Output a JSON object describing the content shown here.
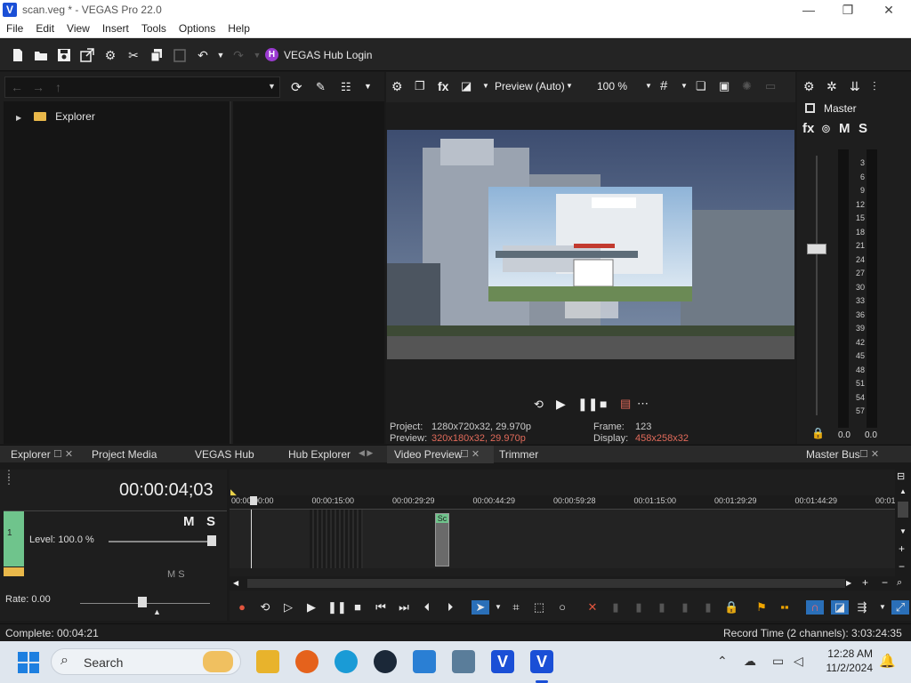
{
  "window": {
    "title": "scan.veg * - VEGAS Pro 22.0",
    "minimize": "—",
    "maximize": "❐",
    "close": "✕"
  },
  "menu": [
    "File",
    "Edit",
    "View",
    "Insert",
    "Tools",
    "Options",
    "Help"
  ],
  "toolbar": {
    "hub_login": "VEGAS Hub Login"
  },
  "explorer": {
    "root": "Explorer"
  },
  "preview": {
    "mode": "Preview (Auto)",
    "zoom": "100 %",
    "project_label": "Project:",
    "project_value": "1280x720x32, 29.970p",
    "preview_label": "Preview:",
    "preview_value": "320x180x32, 29.970p",
    "frame_label": "Frame:",
    "frame_value": "123",
    "display_label": "Display:",
    "display_value": "458x258x32"
  },
  "master": {
    "label": "Master",
    "m": "M",
    "s": "S",
    "scale": [
      "3",
      "6",
      "9",
      "12",
      "15",
      "18",
      "21",
      "24",
      "27",
      "30",
      "33",
      "36",
      "39",
      "42",
      "45",
      "48",
      "51",
      "54",
      "57"
    ],
    "left_value": "0.0",
    "right_value": "0.0"
  },
  "dock_tabs": [
    "Explorer",
    "Project Media",
    "VEGAS Hub",
    "Hub Explorer",
    "Video Preview",
    "Trimmer",
    "Master Bus"
  ],
  "timeline": {
    "timecode": "00:00:04;03",
    "track_m": "M",
    "track_s": "S",
    "level": "Level: 100.0 %",
    "rate": "Rate: 0.00",
    "event_label": "Sc",
    "ticks": [
      "00:00:00:00",
      "00:00:15:00",
      "00:00:29:29",
      "00:00:44:29",
      "00:00:59:28",
      "00:01:15:00",
      "00:01:29:29",
      "00:01:44:29",
      "00:01:"
    ]
  },
  "status": {
    "left": "Complete: 00:04:21",
    "right": "Record Time (2 channels): 3:03:24:35"
  },
  "taskbar": {
    "search": "Search",
    "time": "12:28 AM",
    "date": "11/2/2024"
  }
}
